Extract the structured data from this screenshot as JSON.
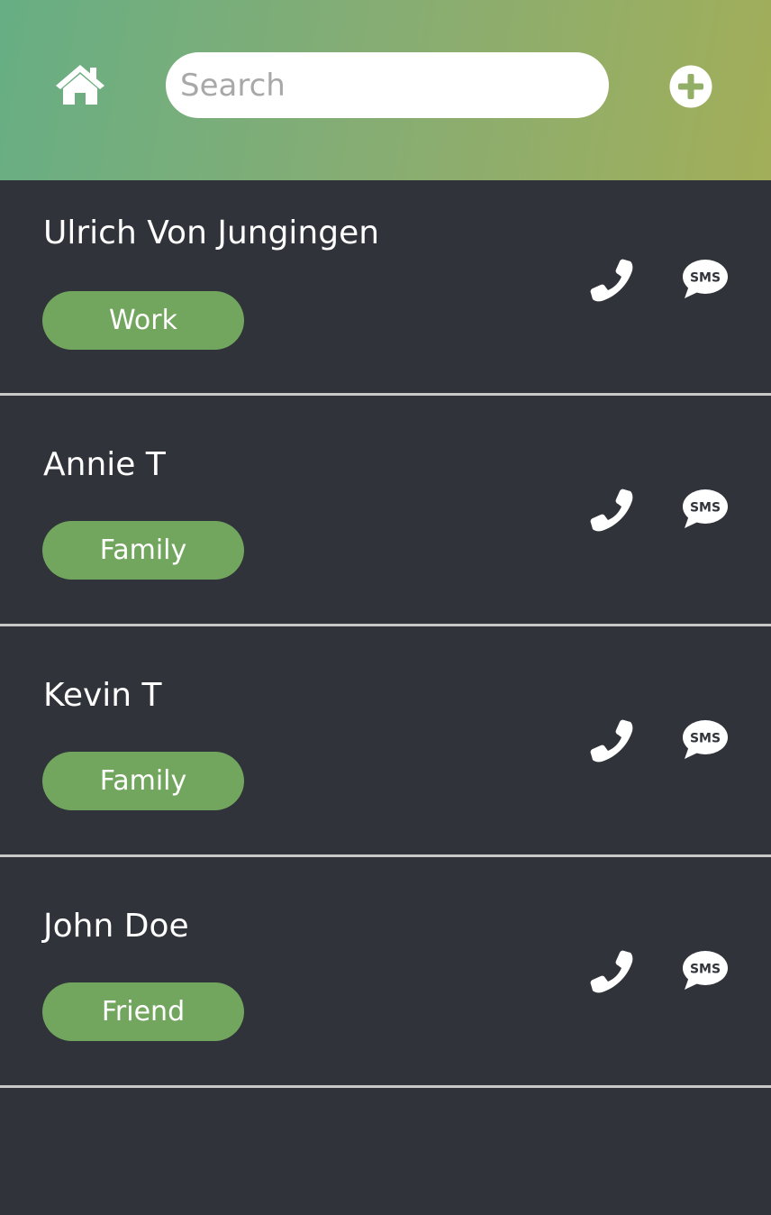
{
  "header": {
    "home_icon": "home-icon",
    "search": {
      "placeholder": "Search",
      "value": ""
    },
    "add_icon": "plus-circle-icon",
    "gradient_colors": [
      "#67ae84",
      "#a2ae59"
    ]
  },
  "contacts": [
    {
      "name": "Ulrich Von Jungingen",
      "tag": "Work"
    },
    {
      "name": "Annie T",
      "tag": "Family"
    },
    {
      "name": "Kevin T",
      "tag": "Family"
    },
    {
      "name": "John Doe",
      "tag": "Friend"
    }
  ],
  "icons": {
    "call": "phone-icon",
    "sms": "sms-icon",
    "sms_text": "SMS"
  },
  "colors": {
    "background": "#303339",
    "tag": "#72a65e",
    "divider": "#c8c8c8"
  }
}
